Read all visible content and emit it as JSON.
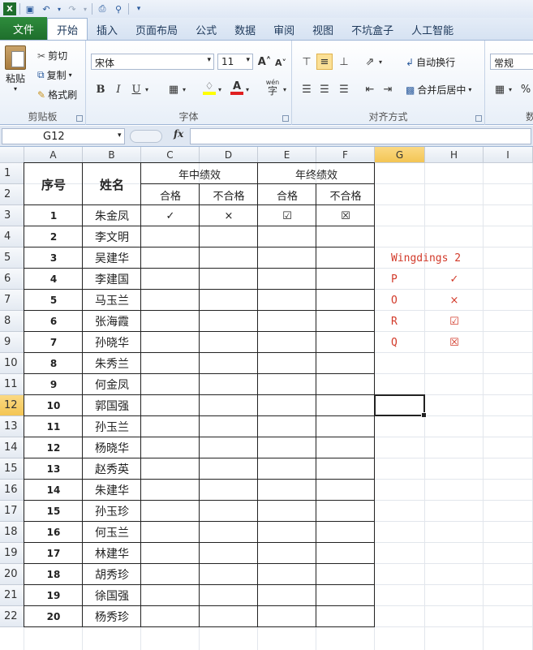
{
  "tabs": [
    "文件",
    "开始",
    "插入",
    "页面布局",
    "公式",
    "数据",
    "审阅",
    "视图",
    "不坑盒子",
    "人工智能"
  ],
  "ribbon": {
    "clipboard": {
      "paste": "粘贴",
      "cut": "剪切",
      "copy": "复制",
      "format_painter": "格式刷",
      "label": "剪贴板"
    },
    "font": {
      "name": "宋体",
      "size": "11",
      "label": "字体",
      "wen": "wén"
    },
    "alignment": {
      "wrap": "自动换行",
      "merge": "合并后居中",
      "label": "对齐方式"
    },
    "number": {
      "format": "常规",
      "label": "数",
      "percent": "%"
    }
  },
  "formula_bar": {
    "name_box": "G12",
    "fx": "fx",
    "value": ""
  },
  "columns": [
    "A",
    "B",
    "C",
    "D",
    "E",
    "F",
    "G",
    "H",
    "I"
  ],
  "rows": [
    "1",
    "2",
    "3",
    "4",
    "5",
    "6",
    "7",
    "8",
    "9",
    "10",
    "11",
    "12",
    "13",
    "14",
    "15",
    "16",
    "17",
    "18",
    "19",
    "20",
    "21",
    "22"
  ],
  "table": {
    "header_seq": "序号",
    "header_name": "姓名",
    "mid_year": "年中绩效",
    "year_end": "年终绩效",
    "pass": "合格",
    "fail": "不合格",
    "records": [
      {
        "no": "1",
        "name": "朱金凤",
        "c": "✓",
        "d": "×",
        "e": "☑",
        "f": "☒"
      },
      {
        "no": "2",
        "name": "李文明"
      },
      {
        "no": "3",
        "name": "吴建华"
      },
      {
        "no": "4",
        "name": "李建国"
      },
      {
        "no": "5",
        "name": "马玉兰"
      },
      {
        "no": "6",
        "name": "张海霞"
      },
      {
        "no": "7",
        "name": "孙晓华"
      },
      {
        "no": "8",
        "name": "朱秀兰"
      },
      {
        "no": "9",
        "name": "何金凤"
      },
      {
        "no": "10",
        "name": "郭国强"
      },
      {
        "no": "11",
        "name": "孙玉兰"
      },
      {
        "no": "12",
        "name": "杨晓华"
      },
      {
        "no": "13",
        "name": "赵秀英"
      },
      {
        "no": "14",
        "name": "朱建华"
      },
      {
        "no": "15",
        "name": "孙玉珍"
      },
      {
        "no": "16",
        "name": "何玉兰"
      },
      {
        "no": "17",
        "name": "林建华"
      },
      {
        "no": "18",
        "name": "胡秀珍"
      },
      {
        "no": "19",
        "name": "徐国强"
      },
      {
        "no": "20",
        "name": "杨秀珍"
      }
    ]
  },
  "legend": {
    "title": "Wingdings 2",
    "items": [
      {
        "key": "P",
        "symbol": "✓"
      },
      {
        "key": "O",
        "symbol": "×"
      },
      {
        "key": "R",
        "symbol": "☑"
      },
      {
        "key": "Q",
        "symbol": "☒"
      }
    ]
  }
}
